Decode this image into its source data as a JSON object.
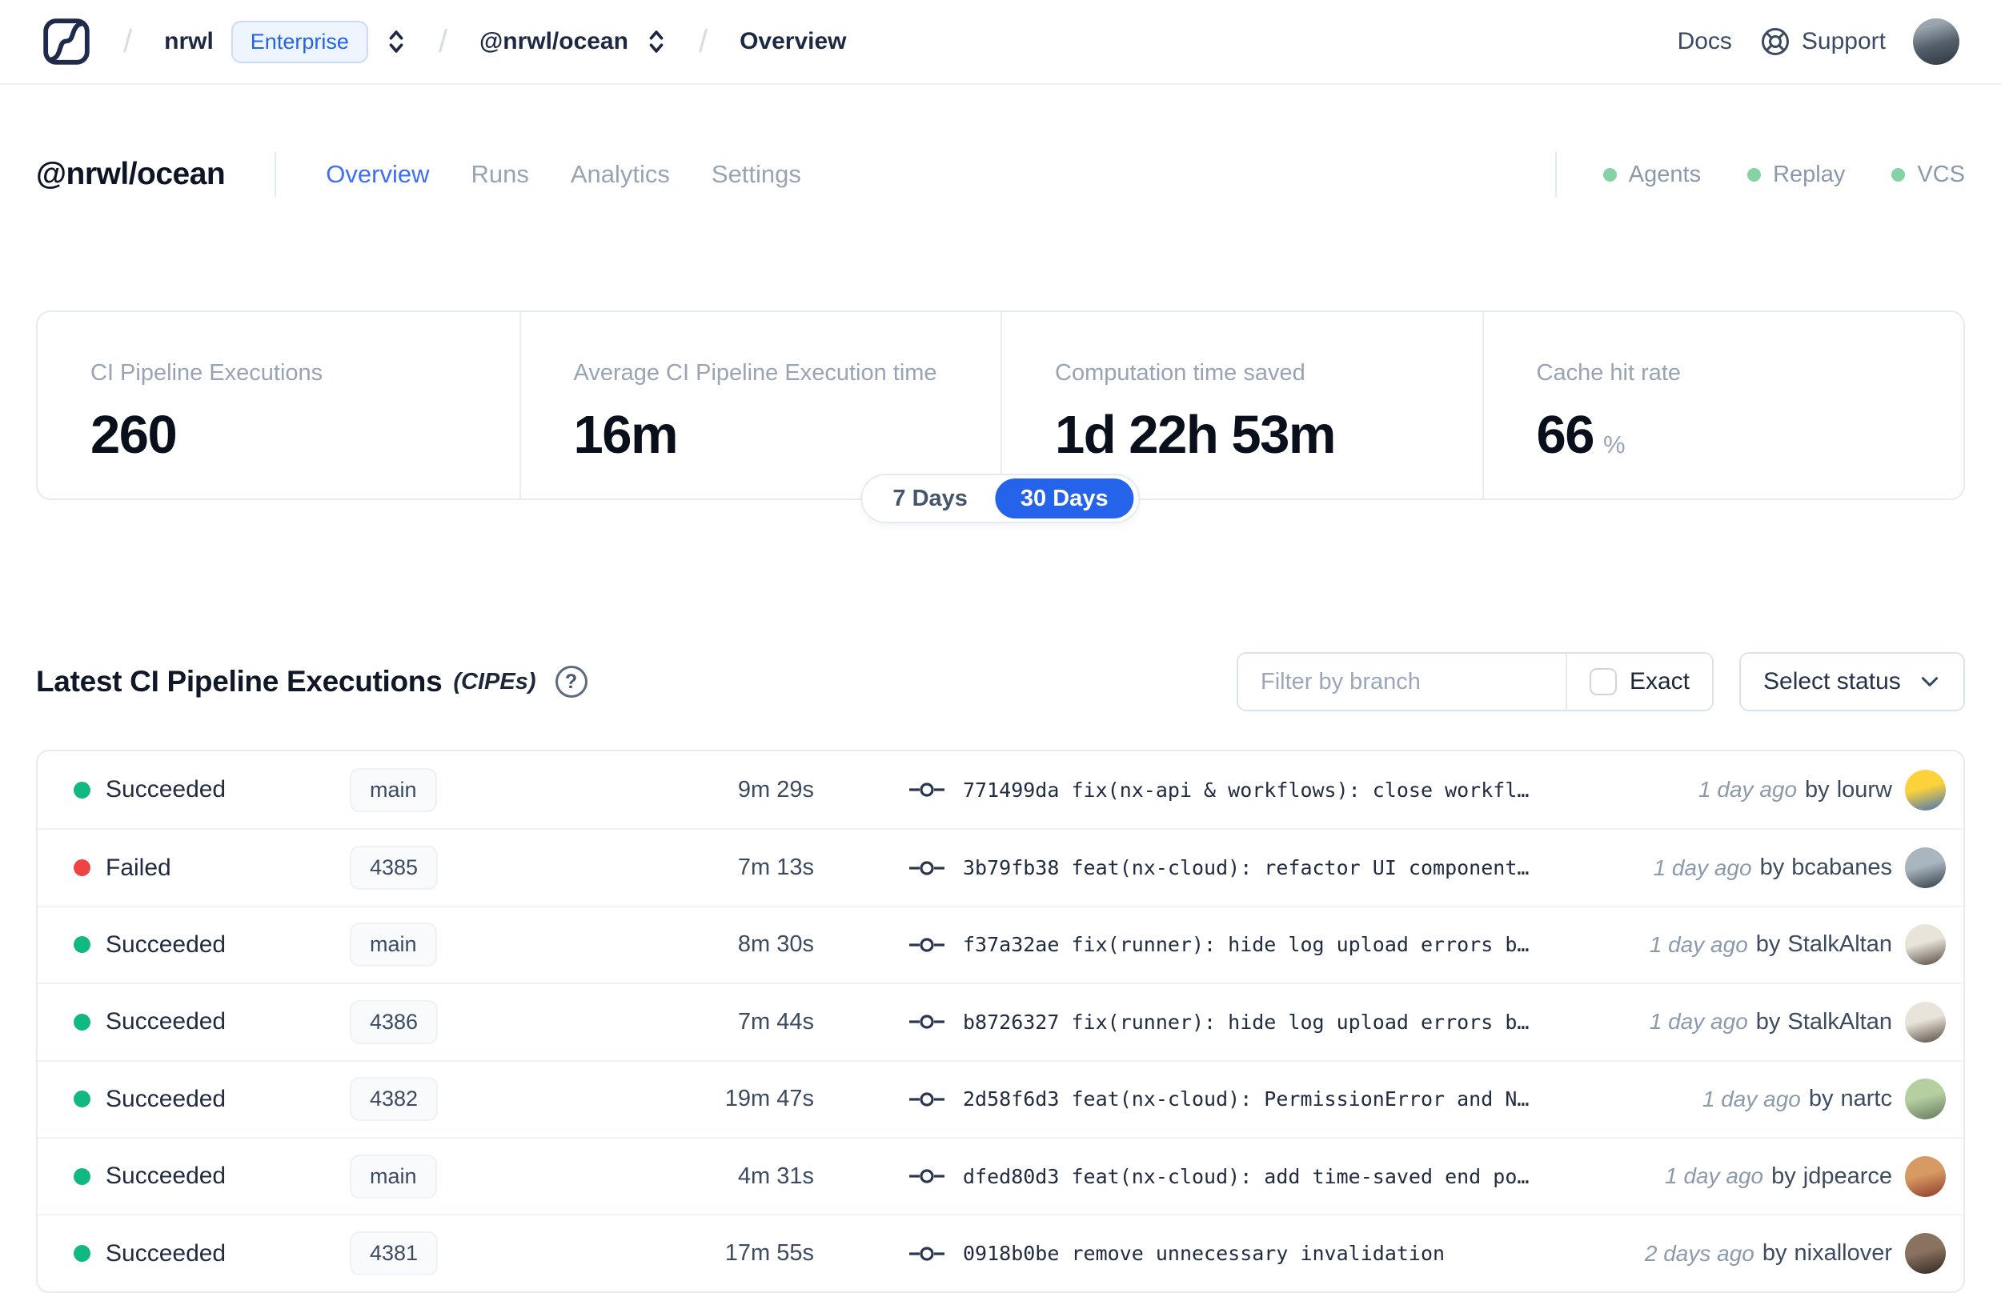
{
  "nav": {
    "separator": "/",
    "org": "nrwl",
    "org_badge": "Enterprise",
    "workspace": "@nrwl/ocean",
    "page": "Overview",
    "docs": "Docs",
    "support": "Support"
  },
  "header": {
    "title": "@nrwl/ocean",
    "tabs": [
      {
        "label": "Overview",
        "active": true
      },
      {
        "label": "Runs",
        "active": false
      },
      {
        "label": "Analytics",
        "active": false
      },
      {
        "label": "Settings",
        "active": false
      }
    ],
    "integrations": [
      {
        "label": "Agents"
      },
      {
        "label": "Replay"
      },
      {
        "label": "VCS"
      }
    ],
    "integration_dot_color": "#85d3a4"
  },
  "stats": {
    "cards": [
      {
        "label": "CI Pipeline Executions",
        "value": "260",
        "suffix": ""
      },
      {
        "label": "Average CI Pipeline Execution time",
        "value": "16m",
        "suffix": ""
      },
      {
        "label": "Computation time saved",
        "value": "1d 22h 53m",
        "suffix": ""
      },
      {
        "label": "Cache hit rate",
        "value": "66",
        "suffix": "%"
      }
    ],
    "range_toggle": {
      "options": [
        "7 Days",
        "30 Days"
      ],
      "selected": "30 Days",
      "selected_color": "#2563eb"
    }
  },
  "cipes": {
    "title": "Latest CI Pipeline Executions",
    "title_suffix": "(CIPEs)",
    "filter_placeholder": "Filter by branch",
    "exact_label": "Exact",
    "status_filter_label": "Select status",
    "by_label": "by",
    "rows": [
      {
        "status": "Succeeded",
        "status_color": "#10b981",
        "branch": "main",
        "duration": "9m 29s",
        "commit_hash": "771499da",
        "commit_message": "fix(nx-api & workflows): close workfl…",
        "time_ago": "1 day ago",
        "author": "lourw",
        "avatar_colors": [
          "#fbd23c",
          "#4472b8"
        ]
      },
      {
        "status": "Failed",
        "status_color": "#ef4444",
        "branch": "4385",
        "duration": "7m 13s",
        "commit_hash": "3b79fb38",
        "commit_message": "feat(nx-cloud): refactor UI component…",
        "time_ago": "1 day ago",
        "author": "bcabanes",
        "avatar_colors": [
          "#aab6bf",
          "#323b46"
        ]
      },
      {
        "status": "Succeeded",
        "status_color": "#10b981",
        "branch": "main",
        "duration": "8m 30s",
        "commit_hash": "f37a32ae",
        "commit_message": "fix(runner): hide log upload errors b…",
        "time_ago": "1 day ago",
        "author": "StalkAltan",
        "avatar_colors": [
          "#e9e4da",
          "#54493f"
        ]
      },
      {
        "status": "Succeeded",
        "status_color": "#10b981",
        "branch": "4386",
        "duration": "7m 44s",
        "commit_hash": "b8726327",
        "commit_message": "fix(runner): hide log upload errors b…",
        "time_ago": "1 day ago",
        "author": "StalkAltan",
        "avatar_colors": [
          "#e9e4da",
          "#54493f"
        ]
      },
      {
        "status": "Succeeded",
        "status_color": "#10b981",
        "branch": "4382",
        "duration": "19m 47s",
        "commit_hash": "2d58f6d3",
        "commit_message": "feat(nx-cloud): PermissionError and N…",
        "time_ago": "1 day ago",
        "author": "nartc",
        "avatar_colors": [
          "#b5cfa0",
          "#66785c"
        ]
      },
      {
        "status": "Succeeded",
        "status_color": "#10b981",
        "branch": "main",
        "duration": "4m 31s",
        "commit_hash": "dfed80d3",
        "commit_message": "feat(nx-cloud): add time-saved end po…",
        "time_ago": "1 day ago",
        "author": "jdpearce",
        "avatar_colors": [
          "#d89a63",
          "#8e3b2c"
        ]
      },
      {
        "status": "Succeeded",
        "status_color": "#10b981",
        "branch": "4381",
        "duration": "17m 55s",
        "commit_hash": "0918b0be",
        "commit_message": "remove unnecessary invalidation",
        "time_ago": "2 days ago",
        "author": "nixallover",
        "avatar_colors": [
          "#8a7260",
          "#2f2721"
        ]
      }
    ]
  },
  "icons": {
    "help_glyph": "?"
  }
}
